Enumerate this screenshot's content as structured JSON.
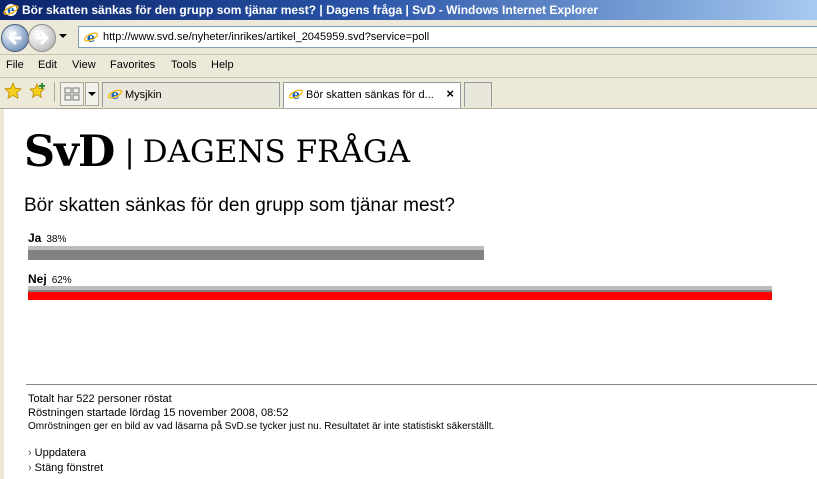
{
  "window": {
    "title": "Bör skatten sänkas för den grupp som tjänar mest? | Dagens fråga | SvD - Windows Internet Explorer"
  },
  "address": {
    "url": "http://www.svd.se/nyheter/inrikes/artikel_2045959.svd?service=poll"
  },
  "menu": [
    "File",
    "Edit",
    "View",
    "Favorites",
    "Tools",
    "Help"
  ],
  "tabs": [
    {
      "label": "Mysjkin"
    },
    {
      "label": "Bör skatten sänkas för d...",
      "close": "×"
    }
  ],
  "page": {
    "logo_main": "SvD",
    "logo_sep": "|",
    "logo_sub": "DAGENS FRÅGA",
    "question": "Bör skatten sänkas för den grupp som tjänar mest?",
    "options": [
      {
        "label": "Ja",
        "percent": "38%",
        "fraction": 0.38,
        "color": "#828282"
      },
      {
        "label": "Nej",
        "percent": "62%",
        "fraction": 0.62,
        "color": "#ff0000"
      }
    ],
    "footer": {
      "total": "Totalt har 522 personer röstat",
      "started": "Röstningen startade lördag 15 november 2008, 08:52",
      "note": "Omröstningen ger en bild av vad läsarna på SvD.se tycker just nu. Resultatet är inte statistiskt säkerställt."
    },
    "links": {
      "chev": "›",
      "update": "Uppdatera",
      "close": "Stäng fönstret"
    }
  }
}
